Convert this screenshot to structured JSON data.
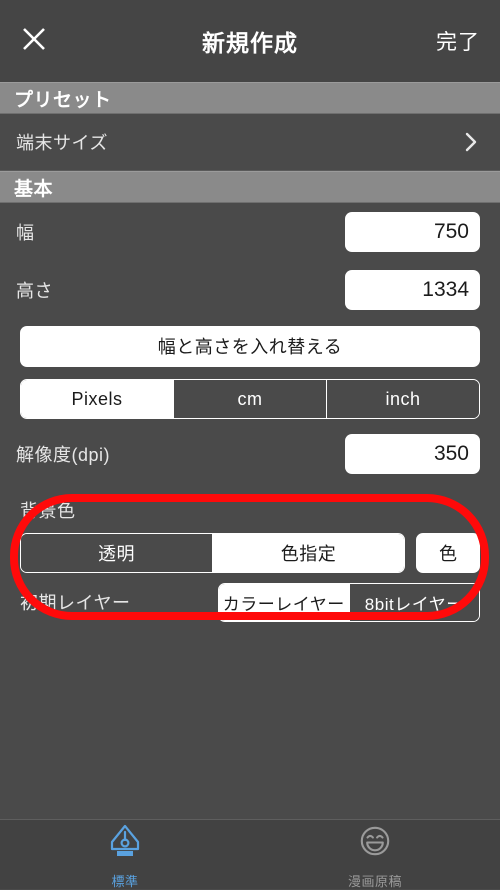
{
  "header": {
    "title": "新規作成",
    "close_icon": "close-x-icon",
    "done_label": "完了"
  },
  "sections": {
    "preset": {
      "title": "プリセット",
      "rows": [
        {
          "label": "端末サイズ",
          "accessory_icon": "chevron-right-icon"
        }
      ]
    },
    "basic": {
      "title": "基本",
      "width": {
        "label": "幅",
        "value": "750"
      },
      "height": {
        "label": "高さ",
        "value": "1334"
      },
      "swap_button": {
        "label": "幅と高さを入れ替える"
      },
      "units": {
        "options": [
          {
            "label": "Pixels",
            "selected": true
          },
          {
            "label": "cm",
            "selected": false
          },
          {
            "label": "inch",
            "selected": false
          }
        ]
      },
      "resolution": {
        "label": "解像度(dpi)",
        "value": "350"
      },
      "background_color": {
        "label": "背景色",
        "options": [
          {
            "label": "透明",
            "selected": false
          },
          {
            "label": "色指定",
            "selected": true
          }
        ],
        "color_button": {
          "label": "色"
        }
      },
      "initial_layer": {
        "label": "初期レイヤー",
        "options": [
          {
            "label": "カラーレイヤー",
            "selected": true
          },
          {
            "label": "8bitレイヤー",
            "selected": false
          }
        ]
      }
    }
  },
  "annotation": {
    "shape": "oval-highlight",
    "color": "#ff0a0a",
    "targets": "背景色"
  },
  "tab_bar": {
    "tabs": [
      {
        "label": "標準",
        "icon": "pen-nib-icon",
        "active": true
      },
      {
        "label": "漫画原稿",
        "icon": "smiley-face-icon",
        "active": false
      }
    ],
    "active_color": "#5aa2e0",
    "inactive_color": "#9a9a9a"
  }
}
